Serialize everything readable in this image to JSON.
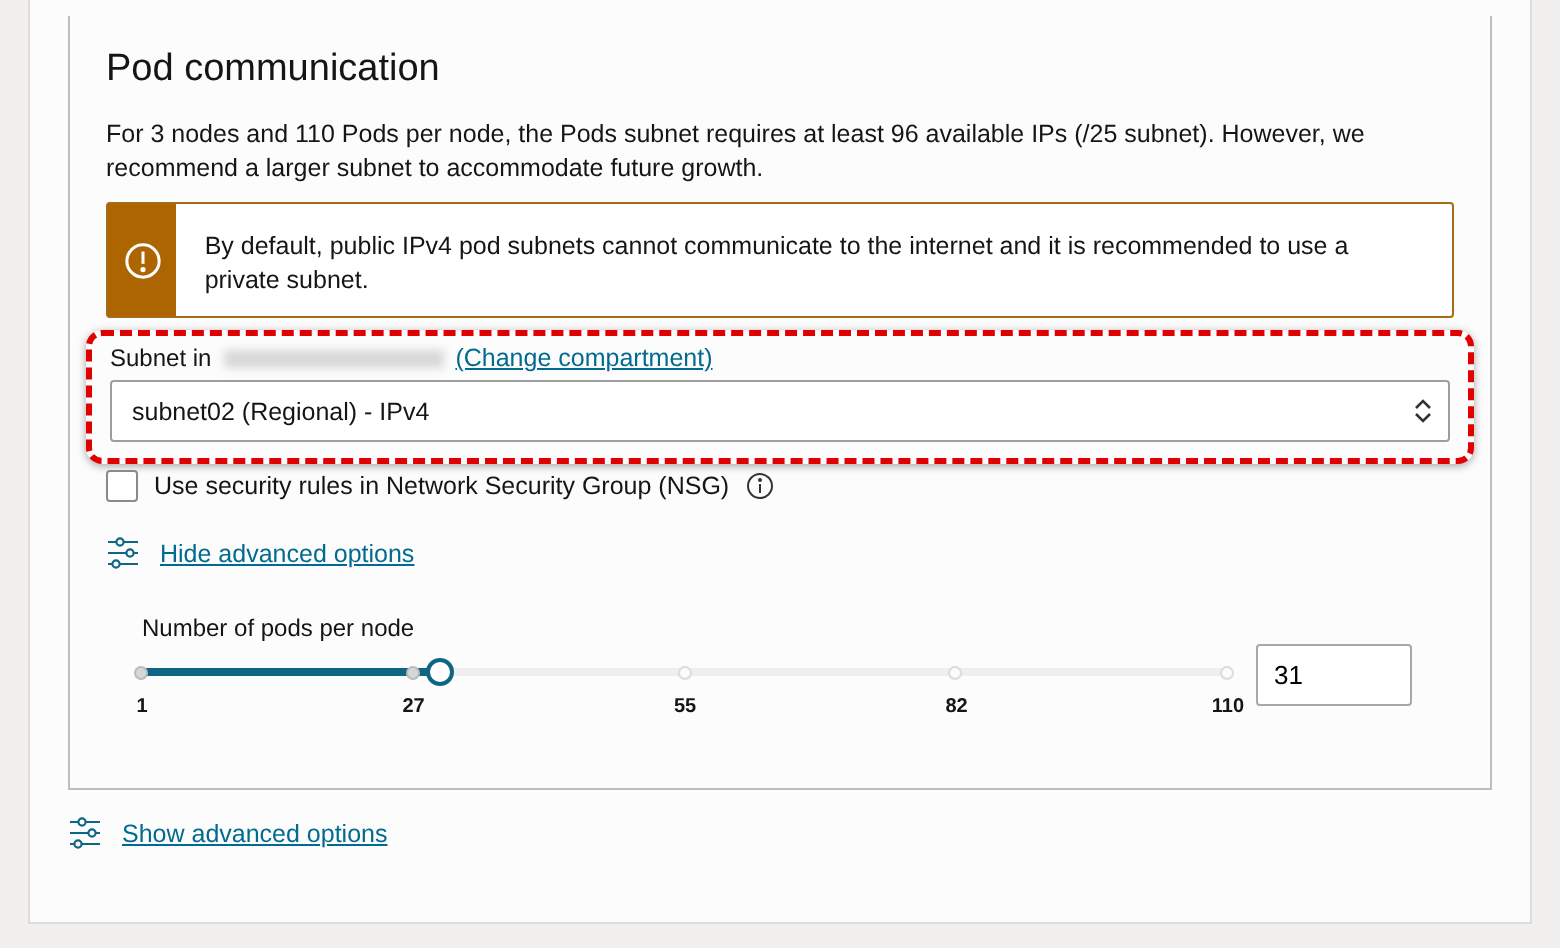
{
  "section": {
    "title": "Pod communication",
    "description": "For 3 nodes and 110 Pods per node, the Pods subnet requires at least 96 available IPs (/25 subnet). However, we recommend a larger subnet to accommodate future growth.",
    "warning": "By default, public IPv4 pod subnets cannot communicate to the internet and it is recommended to use a private subnet.",
    "subnet_label": "Subnet in",
    "change_link": "(Change compartment)",
    "subnet_value": "subnet02 (Regional) - IPv4",
    "highlighted": true,
    "nsg": {
      "label": "Use security rules in Network Security Group (NSG)",
      "checked": false
    },
    "advanced_link": "Hide advanced options",
    "slider": {
      "label": "Number of pods per node",
      "level": 0.275,
      "ticks": [
        "1",
        "27",
        "55",
        "82",
        "110"
      ],
      "value": "31"
    }
  },
  "footer_link": "Show advanced options"
}
